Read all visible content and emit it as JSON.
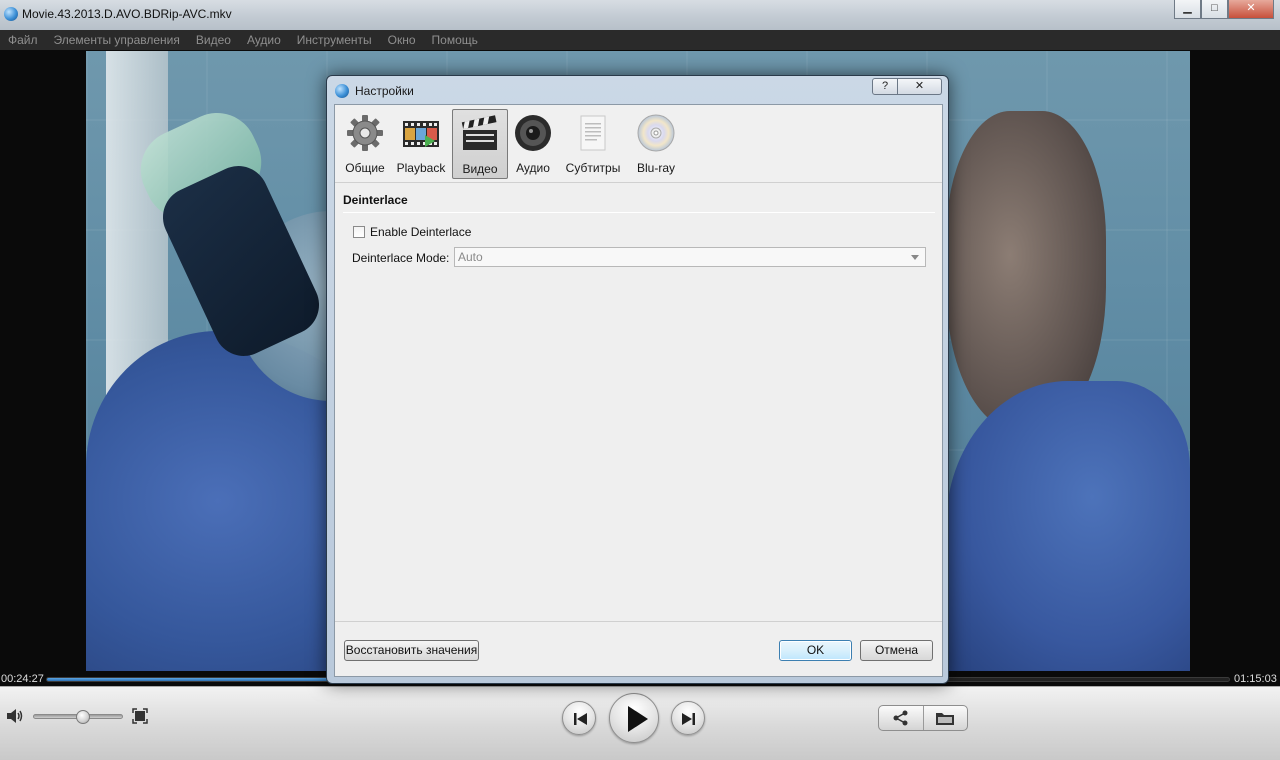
{
  "window": {
    "title": "Movie.43.2013.D.AVO.BDRip-AVC.mkv",
    "minimize": "▁",
    "maximize": "□",
    "close": "✕"
  },
  "menu": [
    "Файл",
    "Элементы управления",
    "Видео",
    "Аудио",
    "Инструменты",
    "Окно",
    "Помощь"
  ],
  "player": {
    "time_current": "00:24:27",
    "time_total": "01:15:03",
    "progress": 0.326,
    "volume": 0.55
  },
  "dialog": {
    "title": "Настройки",
    "help": "?",
    "close": "✕",
    "tabs": [
      {
        "label": "Общие",
        "icon": "gear-icon"
      },
      {
        "label": "Playback",
        "icon": "film-strip-icon"
      },
      {
        "label": "Видео",
        "icon": "clapperboard-icon",
        "selected": true
      },
      {
        "label": "Аудио",
        "icon": "speaker-icon"
      },
      {
        "label": "Субтитры",
        "icon": "document-icon"
      },
      {
        "label": "Blu-ray",
        "icon": "disc-icon"
      }
    ],
    "section_title": "Deinterlace",
    "enable_label": "Enable Deinterlace",
    "enable_checked": false,
    "mode_label": "Deinterlace Mode:",
    "mode_value": "Auto",
    "restore_button": "Восстановить значения",
    "ok_button": "OK",
    "cancel_button": "Отмена"
  },
  "colors": {
    "accent": "#2d6fb0",
    "menu_text": "#8f8f8f"
  }
}
